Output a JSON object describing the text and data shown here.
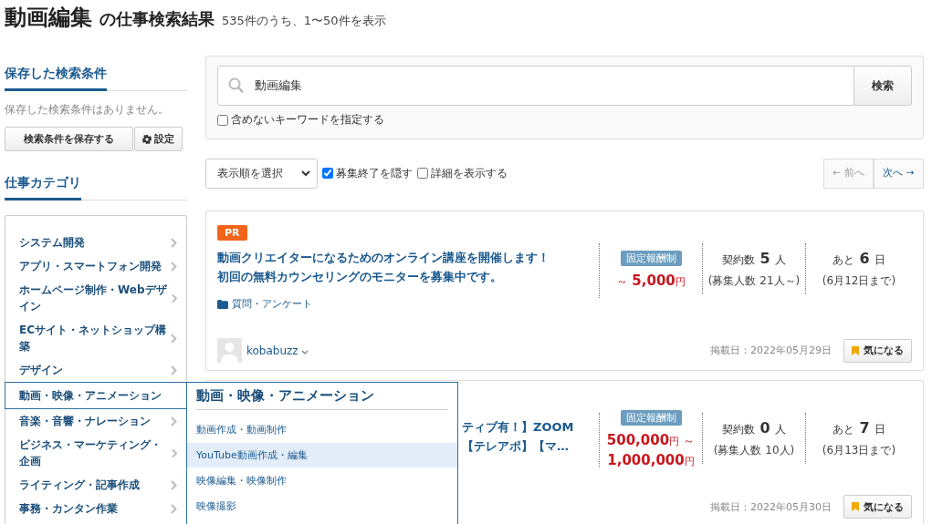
{
  "header": {
    "keyword": "動画編集",
    "suffix": "の仕事検索結果",
    "count_text": "535件のうち、1〜50件を表示"
  },
  "saved_search": {
    "heading": "保存した検索条件",
    "empty_text": "保存した検索条件はありません。",
    "save_button": "検索条件を保存する",
    "settings_button": "設定"
  },
  "categories": {
    "heading": "仕事カテゴリ",
    "items": [
      {
        "label": "システム開発",
        "selected": false
      },
      {
        "label": "アプリ・スマートフォン開発",
        "selected": false
      },
      {
        "label": "ホームページ制作・Webデザイン",
        "selected": false
      },
      {
        "label": "ECサイト・ネットショップ構築",
        "selected": false
      },
      {
        "label": "デザイン",
        "selected": false
      },
      {
        "label": "動画・映像・アニメーション",
        "selected": true
      },
      {
        "label": "音楽・音響・ナレーション",
        "selected": false
      },
      {
        "label": "ビジネス・マーケティング・企画",
        "selected": false
      },
      {
        "label": "ライティング・記事作成",
        "selected": false
      },
      {
        "label": "事務・カンタン作業",
        "selected": false
      }
    ],
    "flyout": {
      "title": "動画・映像・アニメーション",
      "items": [
        {
          "label": "動画作成・動画制作",
          "selected": false
        },
        {
          "label": "YouTube動画作成・編集",
          "selected": true
        },
        {
          "label": "映像編集・映像制作",
          "selected": false
        },
        {
          "label": "映像撮影",
          "selected": false
        }
      ]
    }
  },
  "search": {
    "value": "動画編集",
    "button": "検索",
    "exclude": {
      "label": "含めないキーワードを指定する",
      "checked": false
    }
  },
  "toolbar": {
    "sort_placeholder": "表示順を選択",
    "hide_closed": {
      "label": "募集終了を隠す",
      "checked": true
    },
    "show_detail": {
      "label": "詳細を表示する",
      "checked": false
    },
    "prev": {
      "label": "← 前へ",
      "disabled": true
    },
    "next": {
      "label": "次へ →",
      "disabled": false
    }
  },
  "jobs": [
    {
      "pr_label": "PR",
      "covered": false,
      "title_lines": [
        "動画クリエイターになるためのオンライン講座を開催します！",
        "初回の無料カウンセリングのモニターを募集中です。"
      ],
      "category": "質問・アンケート",
      "pay_type": "固定報酬制",
      "price_lines": [
        {
          "prefix": "～ ",
          "amount": "5,000",
          "unit": "円"
        }
      ],
      "contracts": {
        "label": "契約数",
        "count": "5",
        "unit": "人",
        "note": "(募集人数 21人～)"
      },
      "remaining": {
        "label": "あと",
        "count": "6",
        "unit": "日",
        "note": "(6月12日まで)"
      },
      "client": "kobabuzz",
      "posted": "掲載日：2022年05月29日",
      "bookmark": "気になる"
    },
    {
      "covered": true,
      "title_lines": [
        "ティブ有！】ZOOM",
        "【テレアポ】【マ…"
      ],
      "pay_type": "固定報酬制",
      "price_lines": [
        {
          "amount": "500,000",
          "unit": "円",
          "suffix": " ～"
        },
        {
          "amount": "1,000,000",
          "unit": "円"
        }
      ],
      "contracts": {
        "label": "契約数",
        "count": "0",
        "unit": "人",
        "note": "(募集人数 10人)"
      },
      "remaining": {
        "label": "あと",
        "count": "7",
        "unit": "日",
        "note": "(6月13日まで)"
      },
      "posted": "掲載日：2022年05月30日",
      "bookmark": "気になる"
    }
  ]
}
